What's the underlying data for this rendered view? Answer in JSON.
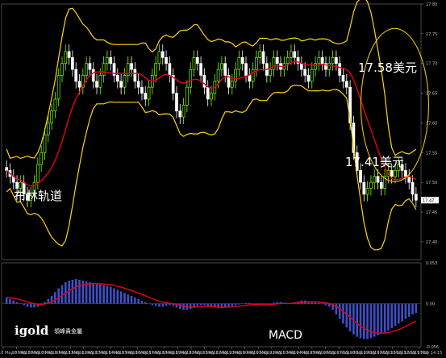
{
  "logo": {
    "brand": "igold",
    "company": "領峰貴金屬"
  },
  "labels": {
    "upper_price": "17.58美元",
    "lower_price": "17.41美元",
    "indicator": "布林轨道",
    "macd": "MACD"
  },
  "colors": {
    "background": "#000000",
    "bollinger": "#ffd700",
    "ma": "#e8001c",
    "bull": "#7cfc00",
    "bear": "#ffffff",
    "macd_bar": "#3d50c8",
    "signal": "#e8001c",
    "grid": "#5a5a5a",
    "tick_text": "#bfbfbf"
  },
  "chart_data": [
    {
      "type": "candlestick",
      "title": "",
      "ylim": [
        17.37,
        17.8
      ],
      "ytick_labels": [
        "17.80",
        "17.75",
        "17.70",
        "17.65",
        "17.60",
        "17.55",
        "17.50",
        "17.47",
        "17.45",
        "17.40"
      ],
      "current_price": 17.47,
      "x_labels": [
        "18 May 07:45",
        "18 May 08:45",
        "18 May 09:45",
        "18 May 10:45",
        "18 May 11:45",
        "18 May 12:45",
        "18 May 13:45",
        "18 May 14:45",
        "18 May 15:45",
        "18 May 16:45",
        "18 May 17:45",
        "18 May 18:45",
        "18 May 19:45",
        "18 May 20:45",
        "18 May 21:45",
        "18 May 22:45",
        "18 May 23:45",
        "19 May 00:45",
        "19 May 01:45",
        "19 May 02:45",
        "19 May 03:45",
        "19 May 04:45",
        "19 May 05:45",
        "19 May 06:15",
        "19 May 07:15",
        "19 May 08:15",
        "19 May 09:15",
        "19 May 10:15",
        "19 May 11:15",
        "19 May 12:15",
        "19 May 13:15",
        "19 May 14:15"
      ],
      "closes": [
        17.52,
        17.51,
        17.5,
        17.49,
        17.5,
        17.48,
        17.47,
        17.48,
        17.5,
        17.53,
        17.55,
        17.58,
        17.6,
        17.62,
        17.64,
        17.68,
        17.7,
        17.72,
        17.71,
        17.69,
        17.67,
        17.66,
        17.68,
        17.7,
        17.69,
        17.67,
        17.66,
        17.68,
        17.7,
        17.71,
        17.7,
        17.68,
        17.67,
        17.66,
        17.68,
        17.7,
        17.69,
        17.67,
        17.66,
        17.65,
        17.64,
        17.66,
        17.68,
        17.7,
        17.72,
        17.71,
        17.7,
        17.68,
        17.65,
        17.62,
        17.61,
        17.63,
        17.66,
        17.69,
        17.71,
        17.7,
        17.68,
        17.66,
        17.64,
        17.65,
        17.67,
        17.69,
        17.7,
        17.68,
        17.66,
        17.67,
        17.69,
        17.71,
        17.7,
        17.68,
        17.67,
        17.69,
        17.71,
        17.72,
        17.7,
        17.68,
        17.69,
        17.71,
        17.7,
        17.69,
        17.7,
        17.71,
        17.72,
        17.71,
        17.7,
        17.69,
        17.68,
        17.67,
        17.69,
        17.7,
        17.71,
        17.7,
        17.69,
        17.7,
        17.71,
        17.7,
        17.68,
        17.67,
        17.66,
        17.6,
        17.55,
        17.52,
        17.5,
        17.48,
        17.49,
        17.5,
        17.51,
        17.5,
        17.49,
        17.51,
        17.52,
        17.51,
        17.52,
        17.53,
        17.52,
        17.51,
        17.5,
        17.48,
        17.47
      ]
    },
    {
      "type": "bar",
      "name": "MACD",
      "ylim": [
        -0.056,
        0.053
      ],
      "ytick_labels": [
        "0.053",
        "0.00",
        "-0.056"
      ],
      "values": [
        0.008,
        0.006,
        0.004,
        0.002,
        0.0,
        -0.002,
        -0.004,
        -0.005,
        -0.005,
        -0.004,
        -0.002,
        0.002,
        0.006,
        0.01,
        0.015,
        0.02,
        0.024,
        0.028,
        0.03,
        0.031,
        0.032,
        0.031,
        0.03,
        0.029,
        0.028,
        0.027,
        0.026,
        0.025,
        0.024,
        0.023,
        0.022,
        0.02,
        0.018,
        0.016,
        0.014,
        0.012,
        0.01,
        0.008,
        0.006,
        0.004,
        0.002,
        0.0,
        -0.002,
        -0.003,
        -0.004,
        -0.004,
        -0.003,
        -0.002,
        -0.003,
        -0.005,
        -0.007,
        -0.008,
        -0.008,
        -0.007,
        -0.005,
        -0.003,
        -0.002,
        -0.002,
        -0.003,
        -0.004,
        -0.005,
        -0.006,
        -0.006,
        -0.005,
        -0.004,
        -0.003,
        -0.002,
        -0.001,
        0.0,
        0.001,
        0.001,
        0.0,
        -0.001,
        -0.002,
        -0.002,
        -0.001,
        0.0,
        0.001,
        0.002,
        0.002,
        0.001,
        0.0,
        0.001,
        0.002,
        0.003,
        0.004,
        0.004,
        0.003,
        0.003,
        0.002,
        0.001,
        0.0,
        -0.002,
        -0.004,
        -0.008,
        -0.014,
        -0.02,
        -0.026,
        -0.031,
        -0.036,
        -0.04,
        -0.043,
        -0.045,
        -0.046,
        -0.046,
        -0.045,
        -0.043,
        -0.041,
        -0.039,
        -0.037,
        -0.035,
        -0.032,
        -0.029,
        -0.026,
        -0.023,
        -0.02,
        -0.017,
        -0.014,
        -0.012
      ]
    }
  ]
}
